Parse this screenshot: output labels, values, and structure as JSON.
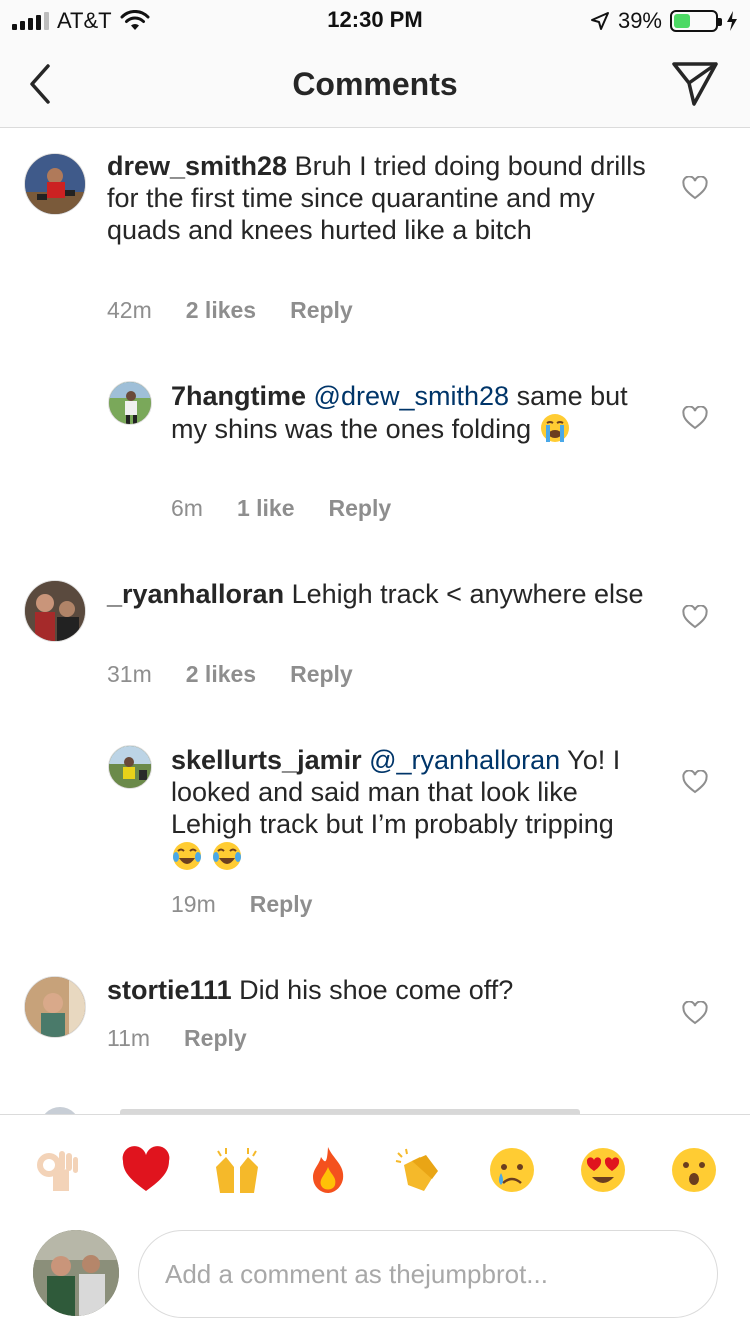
{
  "status_bar": {
    "carrier": "AT&T",
    "time": "12:30 PM",
    "battery_percent": "39%",
    "battery_level": 0.39,
    "battery_color": "#4cd964",
    "icons": [
      "signal-icon",
      "wifi-icon",
      "location-icon",
      "battery-icon",
      "charging-icon"
    ]
  },
  "header": {
    "title": "Comments",
    "icons": [
      "back-chevron-icon",
      "send-direct-icon"
    ]
  },
  "comments": [
    {
      "username": "drew_smith28",
      "text": "Bruh I tried doing bound drills for the first time since quarantine and my quads and knees hurted like a bitch",
      "time": "42m",
      "likes": "2 likes",
      "reply_label": "Reply",
      "is_reply": false
    },
    {
      "username": "7hangtime",
      "mention": "@drew_smith28",
      "text": "same but my shins was the ones folding",
      "emoji": [
        "loudly-crying-face"
      ],
      "time": "6m",
      "likes": "1 like",
      "reply_label": "Reply",
      "is_reply": true
    },
    {
      "username": "_ryanhalloran",
      "text": "Lehigh track < anywhere else",
      "time": "31m",
      "likes": "2 likes",
      "reply_label": "Reply",
      "is_reply": false
    },
    {
      "username": "skellurts_jamir",
      "mention": "@_ryanhalloran",
      "text": "Yo! I looked and said man that look like Lehigh track but I’m probably tripping",
      "emoji": [
        "tears-of-joy-face",
        "tears-of-joy-face"
      ],
      "time": "19m",
      "reply_label": "Reply",
      "is_reply": true
    },
    {
      "username": "stortie111",
      "text": "Did his shoe come off?",
      "time": "11m",
      "reply_label": "Reply",
      "is_reply": false
    }
  ],
  "quick_reactions": [
    "ok-hand",
    "red-heart",
    "raising-hands",
    "fire",
    "clapping-hands",
    "crying-face",
    "heart-eyes",
    "astonished-face"
  ],
  "composer": {
    "placeholder": "Add a comment as thejumpbrot..."
  },
  "colors": {
    "mention": "#003569",
    "meta": "#8e8e8e",
    "divider": "#dbdbdb"
  }
}
